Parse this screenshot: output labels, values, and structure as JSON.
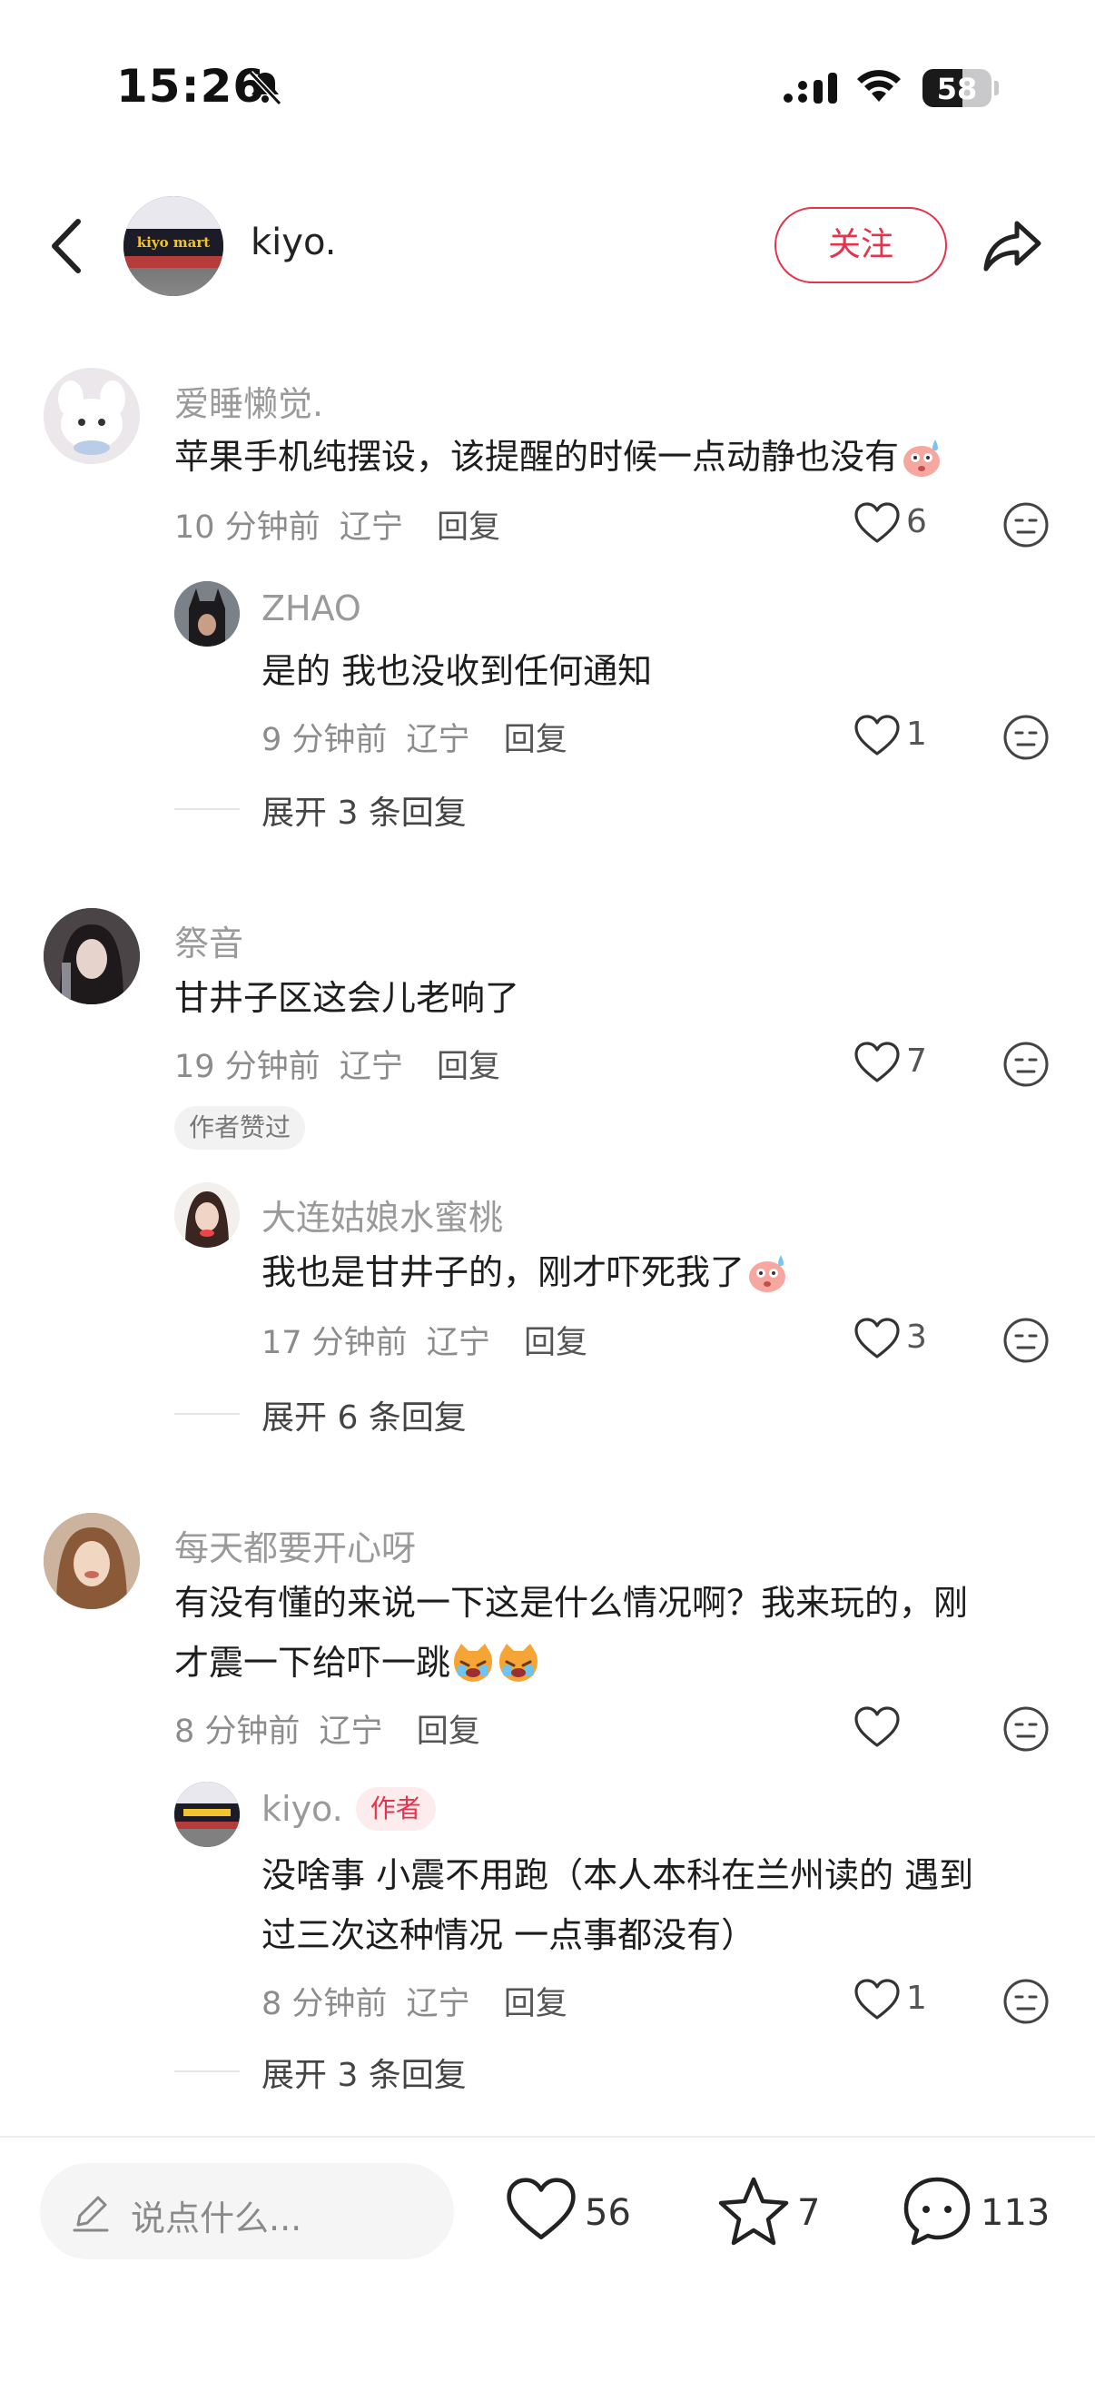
{
  "status": {
    "time": "15:26",
    "battery": "58",
    "battery_level": 0.58
  },
  "header": {
    "name": "kiyo.",
    "follow_label": "关注",
    "avatar_sign": "kiyo mart"
  },
  "comments": [
    {
      "user": "爱睡懒觉.",
      "text": "苹果手机纯摆设，该提醒的时候一点动静也没有",
      "emoji": "sweat-face",
      "time": "10 分钟前",
      "location": "辽宁",
      "reply_label": "回复",
      "likes": "6",
      "reply": {
        "user": "ZHAO",
        "text": "是的 我也没收到任何通知",
        "time": "9 分钟前",
        "location": "辽宁",
        "reply_label": "回复",
        "likes": "1"
      },
      "expand": "展开 3 条回复"
    },
    {
      "user": "祭音",
      "text": "甘井子区这会儿老响了",
      "time": "19 分钟前",
      "location": "辽宁",
      "reply_label": "回复",
      "likes": "7",
      "tag": "作者赞过",
      "reply": {
        "user": "大连姑娘水蜜桃",
        "text": "我也是甘井子的，刚才吓死我了",
        "emoji": "sweat-face",
        "time": "17 分钟前",
        "location": "辽宁",
        "reply_label": "回复",
        "likes": "3"
      },
      "expand": "展开 6 条回复"
    },
    {
      "user": "每天都要开心呀",
      "text_line1": "有没有懂的来说一下这是什么情况啊？我来玩的，刚",
      "text_line2": "才震一下给吓一跳",
      "emoji": "crying-cat-face",
      "time": "8 分钟前",
      "location": "辽宁",
      "reply_label": "回复",
      "likes": "",
      "reply": {
        "user": "kiyo.",
        "author_tag": "作者",
        "text_line1": "没啥事 小震不用跑（本人本科在兰州读的 遇到",
        "text_line2": "过三次这种情况 一点事都没有）",
        "time": "8 分钟前",
        "location": "辽宁",
        "reply_label": "回复",
        "likes": "1"
      },
      "expand": "展开 3 条回复"
    }
  ],
  "bottom": {
    "placeholder": "说点什么...",
    "likes": "56",
    "stars": "7",
    "comments": "113"
  },
  "colors": {
    "accent": "#e5334b",
    "meta": "#8c8c8c",
    "username": "#9a9a9a"
  }
}
